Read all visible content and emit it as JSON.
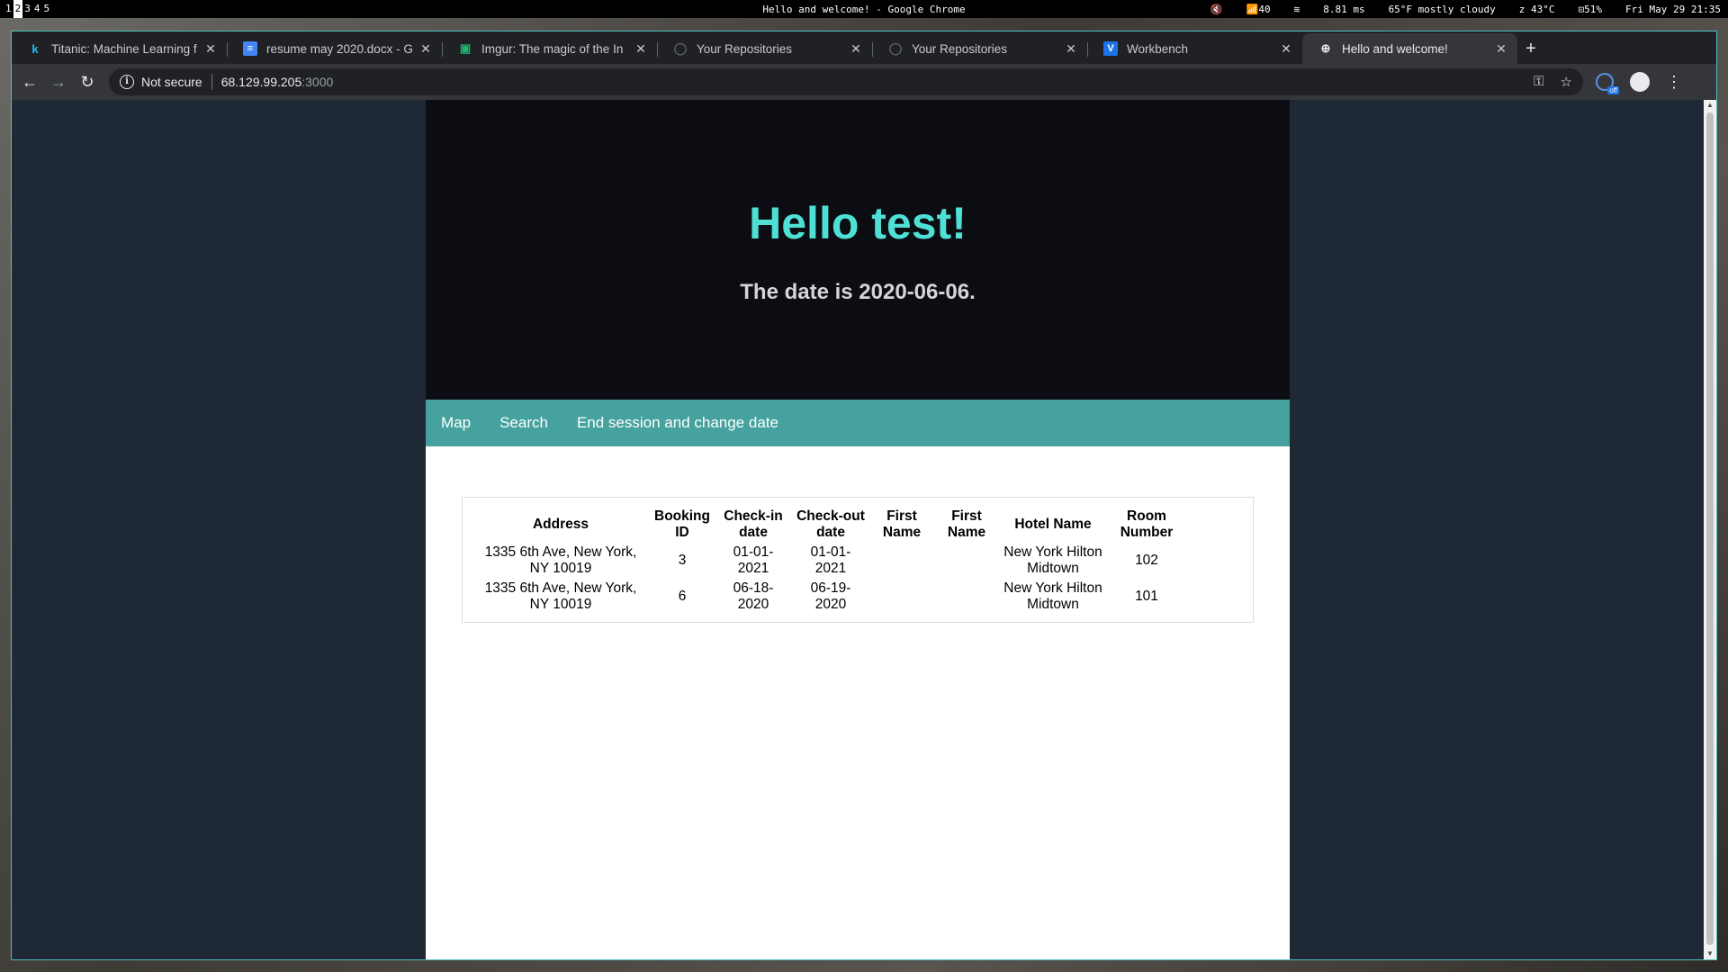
{
  "topbar": {
    "workspaces": [
      "1",
      "2",
      "3",
      "4",
      "5"
    ],
    "active_workspace": "2",
    "window_title": "Hello and welcome! - Google Chrome",
    "status": [
      "🔇",
      "📶40",
      "≋",
      "8.81 ms",
      "65°F mostly cloudy",
      "z 43°C",
      "⊡51%",
      "Fri May 29 21:35"
    ]
  },
  "browser": {
    "tabs": [
      {
        "title": "Titanic: Machine Learning f",
        "icon": "k",
        "icon_color": "#20beff"
      },
      {
        "title": "resume may 2020.docx - G",
        "icon": "≡",
        "icon_color": "#4285f4"
      },
      {
        "title": "Imgur: The magic of the In",
        "icon": "▣",
        "icon_color": "#1bb76e"
      },
      {
        "title": "Your Repositories",
        "icon": "◯",
        "icon_color": "#5f6368"
      },
      {
        "title": "Your Repositories",
        "icon": "◯",
        "icon_color": "#5f6368"
      },
      {
        "title": "Workbench",
        "icon": "V",
        "icon_color": "#1a73e8"
      },
      {
        "title": "Hello and welcome!",
        "icon": "⊕",
        "icon_color": "#e8eaed"
      }
    ],
    "close_glyph": "✕",
    "new_tab_glyph": "+",
    "security_label": "Not secure",
    "url_host": "68.129.99.205",
    "url_port": ":3000",
    "extension_badge": "off"
  },
  "page": {
    "greeting": "Hello test!",
    "date_line": "The date is 2020-06-06.",
    "nav": [
      "Map",
      "Search",
      "End session and change date"
    ],
    "table": {
      "headers": [
        "Address",
        "Booking ID",
        "Check-in date",
        "Check-out date",
        "First Name",
        "First Name",
        "Hotel Name",
        "Room Number"
      ],
      "rows": [
        [
          "1335 6th Ave, New York, NY 10019",
          "3",
          "01-01-2021",
          "01-01-2021",
          "",
          "",
          "New York Hilton Midtown",
          "102"
        ],
        [
          "1335 6th Ave, New York, NY 10019",
          "6",
          "06-18-2020",
          "06-19-2020",
          "",
          "",
          "New York Hilton Midtown",
          "101"
        ]
      ]
    }
  },
  "colors": {
    "hero_bg": "#0b0d12",
    "greeting": "#4fe0d5",
    "nav_bg": "#45a29e",
    "viewport_bg": "#1f2935"
  }
}
